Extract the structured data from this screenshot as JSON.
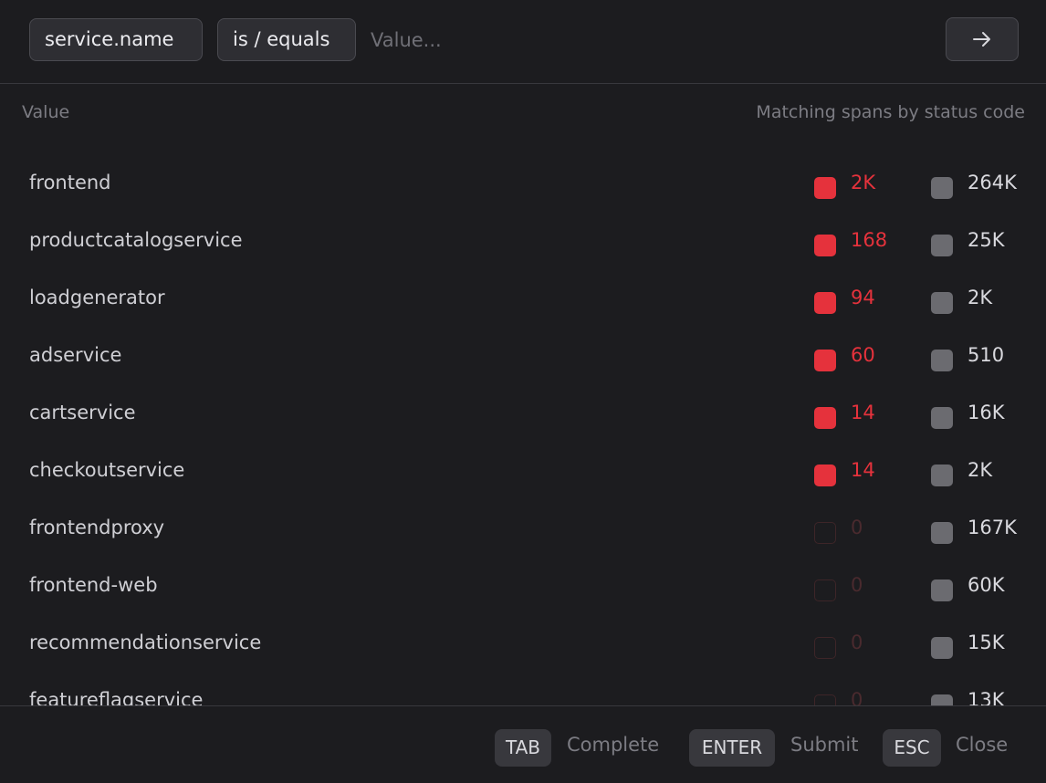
{
  "filter": {
    "attribute": "service.name",
    "operator": "is / equals",
    "value": "",
    "placeholder": "Value...",
    "submit_icon": "arrow-right-icon"
  },
  "columns": {
    "value": "Value",
    "matching": "Matching spans by status code"
  },
  "colors": {
    "error": "#e5323c",
    "ok": "#6b6b70",
    "background": "#1c1c1f"
  },
  "rows": [
    {
      "name": "frontend",
      "error_count": "2K",
      "ok_count": "264K"
    },
    {
      "name": "productcatalogservice",
      "error_count": "168",
      "ok_count": "25K"
    },
    {
      "name": "loadgenerator",
      "error_count": "94",
      "ok_count": "2K"
    },
    {
      "name": "adservice",
      "error_count": "60",
      "ok_count": "510"
    },
    {
      "name": "cartservice",
      "error_count": "14",
      "ok_count": "16K"
    },
    {
      "name": "checkoutservice",
      "error_count": "14",
      "ok_count": "2K"
    },
    {
      "name": "frontendproxy",
      "error_count": "0",
      "ok_count": "167K"
    },
    {
      "name": "frontend-web",
      "error_count": "0",
      "ok_count": "60K"
    },
    {
      "name": "recommendationservice",
      "error_count": "0",
      "ok_count": "15K"
    },
    {
      "name": "featureflagservice",
      "error_count": "0",
      "ok_count": "13K"
    }
  ],
  "footer": {
    "tab_key": "TAB",
    "tab_label": "Complete",
    "enter_key": "ENTER",
    "enter_label": "Submit",
    "esc_key": "ESC",
    "esc_label": "Close"
  }
}
